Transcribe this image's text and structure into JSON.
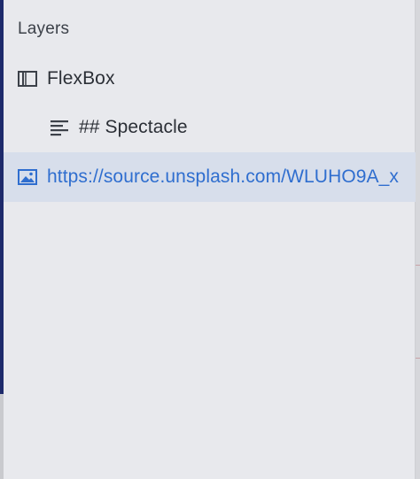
{
  "panel": {
    "title": "Layers"
  },
  "layers": [
    {
      "label": "FlexBox",
      "icon": "column-layout-icon",
      "depth": 0,
      "selected": false
    },
    {
      "label": "## Spectacle",
      "icon": "text-lines-icon",
      "depth": 1,
      "selected": false
    },
    {
      "label": "https://source.unsplash.com/WLUHO9A_x",
      "icon": "image-icon",
      "depth": 0,
      "selected": true
    }
  ],
  "colors": {
    "panel_background": "#e8e9ed",
    "selected_row": "#d7deeb",
    "selected_text": "#2f6ecf",
    "text": "#2b2f36",
    "left_accent": "#1d2a6b"
  }
}
